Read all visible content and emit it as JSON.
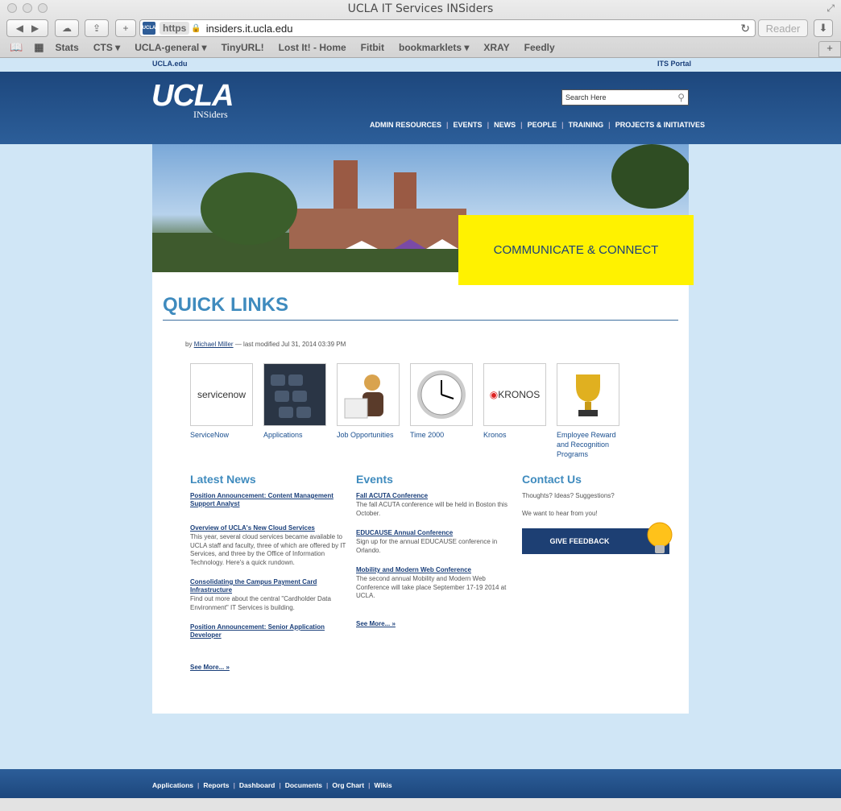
{
  "window": {
    "title": "UCLA IT Services INSiders"
  },
  "toolbar": {
    "https": "https",
    "url": "insiders.it.ucla.edu",
    "reader": "Reader"
  },
  "bookmarks": [
    "Stats",
    "CTS ▾",
    "UCLA-general ▾",
    "TinyURL!",
    "Lost It! - Home",
    "Fitbit",
    "bookmarklets ▾",
    "XRAY",
    "Feedly"
  ],
  "top": {
    "left": "UCLA.edu",
    "right": "ITS Portal"
  },
  "header": {
    "logo": "UCLA",
    "logo_sub": "INSiders",
    "search_placeholder": "Search Here",
    "nav": [
      "ADMIN RESOURCES",
      "EVENTS",
      "NEWS",
      "PEOPLE",
      "TRAINING",
      "PROJECTS & INITIATIVES"
    ]
  },
  "banner": {
    "cta": "COMMUNICATE & CONNECT"
  },
  "page": {
    "title": "QUICK LINKS",
    "by": "by",
    "author": "Michael Miller",
    "modified": "— last modified Jul 31, 2014 03:39 PM"
  },
  "quick_links": [
    {
      "label": "ServiceNow",
      "img_text": "servicenow"
    },
    {
      "label": "Applications",
      "img_text": ""
    },
    {
      "label": "Job Opportunities",
      "img_text": ""
    },
    {
      "label": "Time 2000",
      "img_text": ""
    },
    {
      "label": "Kronos",
      "img_text": "KRONOS"
    },
    {
      "label": "Employee Reward and Recognition Programs",
      "img_text": ""
    }
  ],
  "latest_news": {
    "title": "Latest News",
    "items": [
      {
        "link": "Position Announcement: Content Management Support Analyst",
        "desc": ""
      },
      {
        "link": "Overview of UCLA's New Cloud Services",
        "desc": "This year, several cloud services became available to UCLA staff and faculty, three of which are offered by IT Services, and three by the Office of Information Technology. Here's a quick rundown."
      },
      {
        "link": "Consolidating the Campus Payment Card Infrastructure",
        "desc": "Find out more about the central \"Cardholder Data Environment\" IT Services is building."
      },
      {
        "link": "Position Announcement: Senior Application Developer",
        "desc": ""
      }
    ],
    "see_more": "See More... »"
  },
  "events": {
    "title": "Events",
    "items": [
      {
        "link": "Fall ACUTA Conference",
        "desc": "The fall ACUTA conference will be held in Boston this October."
      },
      {
        "link": "EDUCAUSE Annual Conference",
        "desc": "Sign up for the annual EDUCAUSE conference in Orlando."
      },
      {
        "link": "Mobility and Modern Web Conference",
        "desc": "The second annual Mobility and Modern Web Conference will take place September 17-19 2014 at UCLA."
      }
    ],
    "see_more": "See More... »"
  },
  "contact": {
    "title": "Contact Us",
    "line1": "Thoughts? Ideas? Suggestions?",
    "line2": "We want to hear from you!",
    "button": "GIVE FEEDBACK"
  },
  "footer": [
    "Applications",
    "Reports",
    "Dashboard",
    "Documents",
    "Org Chart",
    "Wikis"
  ]
}
